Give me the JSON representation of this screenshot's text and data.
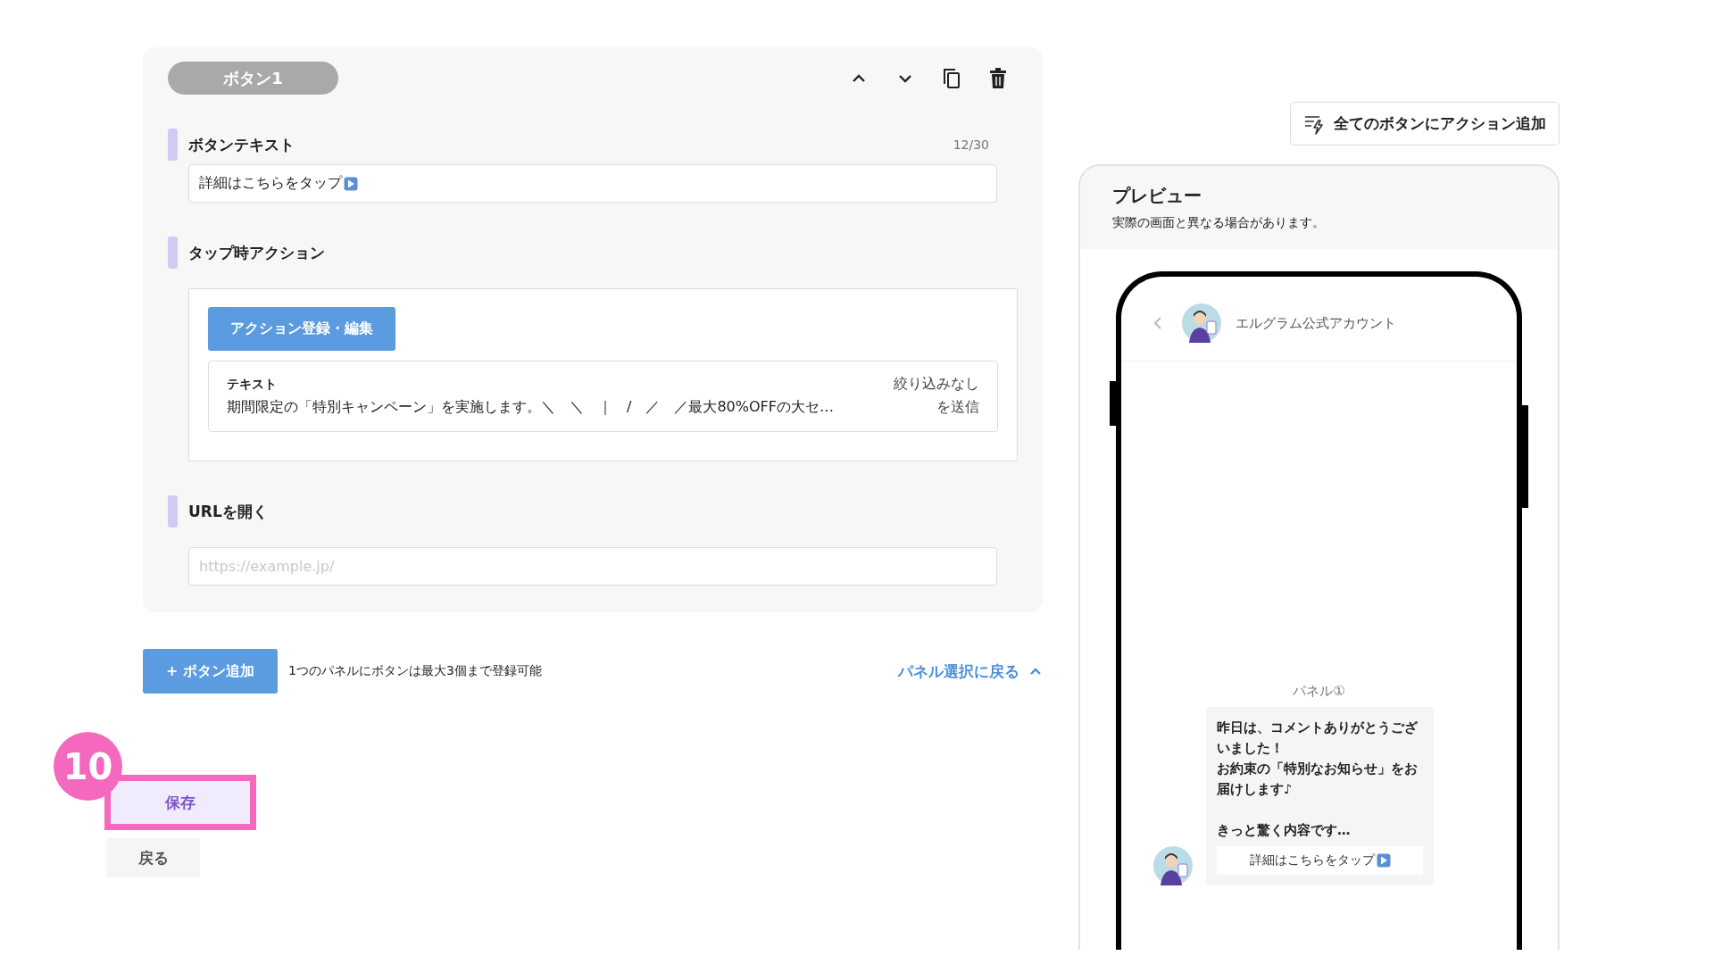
{
  "button_card": {
    "title": "ボタン1",
    "sections": [
      {
        "kind": "text_input",
        "label": "ボタンテキスト",
        "counter": "12/30",
        "value": "詳細はこちらをタップ"
      },
      {
        "kind": "action",
        "label": "タップ時アクション",
        "button": "アクション登録・編集",
        "action": {
          "type": "テキスト",
          "filter": "絞り込みなし",
          "text": "期間限定の「特別キャンペーン」を実施します。＼　＼　｜　/　／　／最大80%OFFの大セ…",
          "suffix": "を送信"
        }
      },
      {
        "kind": "url_input",
        "label": "URLを開く",
        "placeholder": "https://example.jp/"
      }
    ]
  },
  "add_button": "+ ボタン追加",
  "limit_note": "1つのパネルにボタンは最大3個まで登録可能",
  "back_to_panels": "パネル選択に戻る",
  "step_badge": "10",
  "save_button": {
    "label": "保存",
    "highlighted": true
  },
  "back_button": "戻る",
  "add_action_all": "全てのボタンにアクション追加",
  "preview": {
    "title": "プレビュー",
    "subtitle": "実際の画面と異なる場合があります。",
    "account_name": "エルグラム公式アカウント",
    "panel_label": "パネル①",
    "message_paragraphs": [
      [
        "昨日は、コメントありがとうございました！",
        "お約束の「特別なお知らせ」をお届けします♪"
      ],
      [
        "きっと驚く内容です…"
      ]
    ],
    "message_button": "詳細はこちらをタップ"
  }
}
